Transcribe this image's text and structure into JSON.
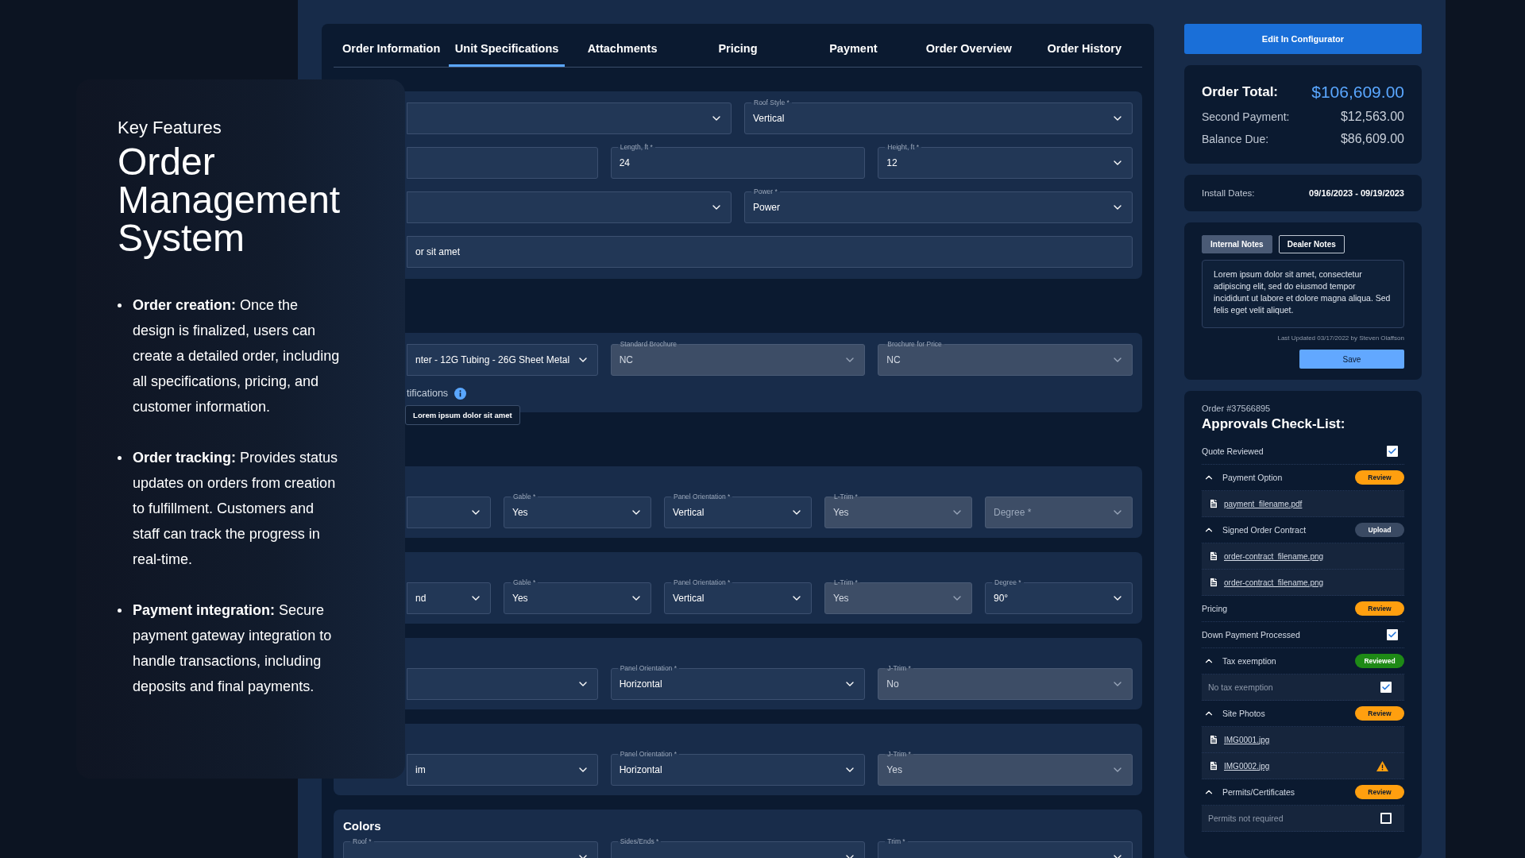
{
  "feature_card": {
    "eyebrow": "Key Features",
    "title": "Order Management System",
    "bullets": [
      "**Order creation:** Once the design is finalized, users can create a detailed order, including all specifications, pricing, and customer information.",
      "**Order tracking:** Provides status updates on orders from creation to fulfillment. Customers and staff can track the progress in real-time.",
      "**Payment integration:** Secure payment gateway integration to handle transactions, including deposits and final payments."
    ]
  },
  "tabs": [
    {
      "label": "Order Information",
      "selected": false
    },
    {
      "label": "Unit Specifications",
      "selected": true
    },
    {
      "label": "Attachments",
      "selected": false
    },
    {
      "label": "Pricing",
      "selected": false
    },
    {
      "label": "Payment",
      "selected": false
    },
    {
      "label": "Order Overview",
      "selected": false
    },
    {
      "label": "Order History",
      "selected": false
    }
  ],
  "sections": [
    {
      "rows": [
        {
          "fields": [
            {
              "kind": "select",
              "disabled": false
            },
            {
              "kind": "select",
              "label": "Roof Style *",
              "value": "Vertical",
              "disabled": false
            }
          ]
        },
        {
          "fields": [
            {
              "kind": "input",
              "disabled": false
            },
            {
              "kind": "input",
              "label": "Length, ft *",
              "value": "24",
              "disabled": false
            },
            {
              "kind": "select",
              "label": "Height, ft *",
              "value": "12",
              "disabled": false
            }
          ]
        },
        {
          "fields": [
            {
              "kind": "select",
              "disabled": false
            },
            {
              "kind": "select",
              "label": "Power *",
              "value": "Power",
              "disabled": false
            }
          ]
        },
        {
          "fields": [
            {
              "kind": "input",
              "value": "or sit amet",
              "disabled": false
            }
          ]
        }
      ]
    },
    {
      "rows": [
        {
          "fields": [
            {
              "kind": "select",
              "value": "nter - 12G Tubing - 26G Sheet Metal",
              "disabled": false
            },
            {
              "kind": "select",
              "label": "Standard Brochure",
              "value": "NC",
              "disabled": true
            },
            {
              "kind": "select",
              "label": "Brochure for Price",
              "value": "NC",
              "disabled": true
            }
          ]
        }
      ],
      "note": {
        "text": "tifications",
        "tooltip": "Lorem ipsum dolor sit amet"
      }
    },
    {
      "rows": [
        {
          "fields": [
            {
              "kind": "select",
              "disabled": false
            },
            {
              "kind": "select",
              "label": "Gable *",
              "value": "Yes",
              "disabled": false
            },
            {
              "kind": "select",
              "label": "Panel Orientation *",
              "value": "Vertical",
              "disabled": false
            },
            {
              "kind": "select",
              "label": "L-Trim *",
              "value": "Yes",
              "disabled": true
            },
            {
              "kind": "select",
              "placeholder": "Degree *",
              "disabled": true
            }
          ]
        }
      ]
    },
    {
      "rows": [
        {
          "fields": [
            {
              "kind": "select",
              "value": "nd",
              "disabled": false
            },
            {
              "kind": "select",
              "label": "Gable *",
              "value": "Yes",
              "disabled": false
            },
            {
              "kind": "select",
              "label": "Panel Orientation *",
              "value": "Vertical",
              "disabled": false
            },
            {
              "kind": "select",
              "label": "L-Trim *",
              "value": "Yes",
              "disabled": true
            },
            {
              "kind": "select",
              "label": "Degree *",
              "value": "90°",
              "disabled": false
            }
          ]
        }
      ]
    },
    {
      "rows": [
        {
          "fields": [
            {
              "kind": "select",
              "disabled": false
            },
            {
              "kind": "select",
              "label": "Panel Orientation *",
              "value": "Horizontal",
              "disabled": false
            },
            {
              "kind": "select",
              "label": "J-Trim *",
              "value": "No",
              "disabled": true
            }
          ]
        }
      ]
    },
    {
      "rows": [
        {
          "fields": [
            {
              "kind": "select",
              "value": "im",
              "disabled": false
            },
            {
              "kind": "select",
              "label": "Panel Orientation *",
              "value": "Horizontal",
              "disabled": false
            },
            {
              "kind": "select",
              "label": "J-Trim *",
              "value": "Yes",
              "disabled": true
            }
          ]
        }
      ]
    },
    {
      "title": "Colors",
      "rows": [
        {
          "fields": [
            {
              "kind": "select",
              "label": "Roof *",
              "disabled": false
            },
            {
              "kind": "select",
              "label": "Sides/Ends *",
              "disabled": false
            },
            {
              "kind": "select",
              "label": "Trim *",
              "disabled": false
            }
          ]
        }
      ]
    }
  ],
  "edit_button": "Edit In Configurator",
  "totals": [
    {
      "kind": "total",
      "label": "Order Total:",
      "value": "$106,609.00"
    },
    {
      "kind": "line",
      "label": "Second Payment:",
      "value": "$12,563.00"
    },
    {
      "kind": "line",
      "label": "Balance Due:",
      "value": "$86,609.00"
    }
  ],
  "install": {
    "label": "Install Dates:",
    "value": "09/16/2023 - 09/19/2023"
  },
  "notes": {
    "tabs": [
      {
        "label": "Internal Notes",
        "selected": true
      },
      {
        "label": "Dealer Notes",
        "selected": false
      }
    ],
    "text": "Lorem ipsum dolor sit amet, consectetur adipiscing elit, sed do eiusmod tempor incididunt ut labore et dolore magna aliqua. Sed felis eget velit aliquet.",
    "updated": "Last Updated 03/17/2022 by Steven Olaffson",
    "save": "Save"
  },
  "checklist": {
    "order": "Order #37566895",
    "title": "Approvals Check-List:",
    "items": [
      {
        "kind": "check",
        "label": "Quote Reviewed",
        "checked": true
      },
      {
        "kind": "group",
        "label": "Payment Option",
        "expanded": true,
        "badge": {
          "text": "Review",
          "kind": "review"
        },
        "children": [
          {
            "kind": "file",
            "name": "payment_filename.pdf",
            "warning": false
          }
        ]
      },
      {
        "kind": "group",
        "label": "Signed Order Contract",
        "expanded": true,
        "badge": {
          "text": "Upload",
          "kind": "upload"
        },
        "children": [
          {
            "kind": "file",
            "name": "order-contract_filename.png",
            "warning": false
          },
          {
            "kind": "file",
            "name": "order-contract_filename.png",
            "warning": false
          }
        ]
      },
      {
        "kind": "status",
        "label": "Pricing",
        "badge": {
          "text": "Review",
          "kind": "review"
        }
      },
      {
        "kind": "check",
        "label": "Down Payment Processed",
        "checked": true
      },
      {
        "kind": "group",
        "label": "Tax exemption",
        "expanded": true,
        "badge": {
          "text": "Reviewed",
          "kind": "reviewed"
        },
        "children": [
          {
            "kind": "option",
            "label": "No tax exemption",
            "checked": true
          }
        ]
      },
      {
        "kind": "group",
        "label": "Site Photos",
        "expanded": true,
        "badge": {
          "text": "Review",
          "kind": "review"
        },
        "children": [
          {
            "kind": "file",
            "name": "IMG0001.jpg",
            "warning": false
          },
          {
            "kind": "file",
            "name": "IMG0002.jpg",
            "warning": true
          }
        ]
      },
      {
        "kind": "group",
        "label": "Permits/Certificates",
        "expanded": true,
        "badge": {
          "text": "Review",
          "kind": "review"
        },
        "children": [
          {
            "kind": "option",
            "label": "Permits not required",
            "checked": false
          }
        ]
      }
    ]
  }
}
